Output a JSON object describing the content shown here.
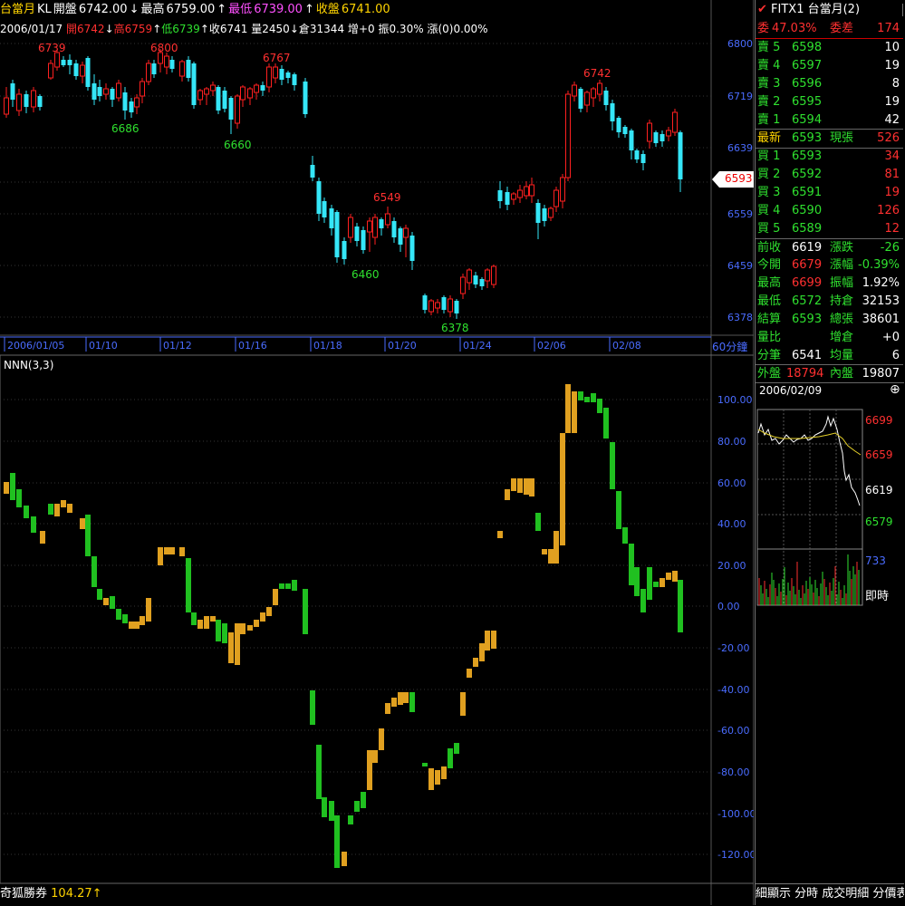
{
  "header": {
    "name": "台當月",
    "kl": "KL",
    "open_label": "開盤",
    "open": "6742.00",
    "high_label": "最高",
    "high": "6759.00",
    "low_label": "最低",
    "low": "6739.00",
    "close_label": "收盤",
    "close": "6741.00"
  },
  "subheader": {
    "date": "2006/01/17",
    "open_label": "開",
    "open": "6742",
    "high_label": "高",
    "high": "6759",
    "low_label": "低",
    "low": "6739",
    "close_label": "收",
    "close": "6741",
    "vol_label": "量",
    "vol": "2450",
    "oi_label": "倉",
    "oi": "31344",
    "inc_label": "增",
    "inc": "+0",
    "amp_label": "振",
    "amp": "0.30%",
    "chg_label": "漲(0)",
    "chg": "0.00%"
  },
  "price_chart": {
    "y_ticks": [
      "6800",
      "6719",
      "6639",
      "6559",
      "6459",
      "6378"
    ],
    "last_price": "6593",
    "x_labels": [
      "2006/01/05",
      "01/10",
      "01/12",
      "01/16",
      "01/18",
      "01/20",
      "01/24",
      "02/06",
      "02/08"
    ],
    "period": "60分鐘",
    "annotations": [
      "6739",
      "6800",
      "6767",
      "6742",
      "6686",
      "6660",
      "6549",
      "6460",
      "6378"
    ]
  },
  "indicator": {
    "name": "NNN(3,3)",
    "y_ticks": [
      "100.00",
      "80.00",
      "60.00",
      "40.00",
      "20.00",
      "0.00",
      "-20.00",
      "-40.00",
      "-60.00",
      "-80.00",
      "-100.00",
      "-120.00"
    ]
  },
  "footer": {
    "broker": "奇狐勝券",
    "value": "104.27↑"
  },
  "quote": {
    "symbol": "FITX1 台當月(2)",
    "ratio_label": "委",
    "ratio": "47.03%",
    "diff_label": "委差",
    "diff": "174",
    "asks": [
      {
        "label": "賣 5",
        "price": "6598",
        "qty": "10"
      },
      {
        "label": "賣 4",
        "price": "6597",
        "qty": "19"
      },
      {
        "label": "賣 3",
        "price": "6596",
        "qty": "8"
      },
      {
        "label": "賣 2",
        "price": "6595",
        "qty": "19"
      },
      {
        "label": "賣 1",
        "price": "6594",
        "qty": "42"
      }
    ],
    "last_label": "最新",
    "last": "6593",
    "cur_label": "現張",
    "cur": "526",
    "bids": [
      {
        "label": "買 1",
        "price": "6593",
        "qty": "34"
      },
      {
        "label": "買 2",
        "price": "6592",
        "qty": "81"
      },
      {
        "label": "買 3",
        "price": "6591",
        "qty": "19"
      },
      {
        "label": "買 4",
        "price": "6590",
        "qty": "126"
      },
      {
        "label": "買 5",
        "price": "6589",
        "qty": "12"
      }
    ],
    "stats": [
      {
        "l1": "前收",
        "v1": "6619",
        "c1": "white",
        "l2": "漲跌",
        "v2": "-26",
        "c2": "green"
      },
      {
        "l1": "今開",
        "v1": "6679",
        "c1": "red",
        "l2": "漲幅",
        "v2": "-0.39%",
        "c2": "green"
      },
      {
        "l1": "最高",
        "v1": "6699",
        "c1": "red",
        "l2": "振幅",
        "v2": "1.92%",
        "c2": "white"
      },
      {
        "l1": "最低",
        "v1": "6572",
        "c1": "green",
        "l2": "持倉",
        "v2": "32153",
        "c2": "white"
      },
      {
        "l1": "結算",
        "v1": "6593",
        "c1": "green",
        "l2": "總張",
        "v2": "38601",
        "c2": "white"
      },
      {
        "l1": "量比",
        "v1": "",
        "c1": "white",
        "l2": "增倉",
        "v2": "+0",
        "c2": "white"
      },
      {
        "l1": "分筆",
        "v1": "6541",
        "c1": "white",
        "l2": "均量",
        "v2": "6",
        "c2": "white"
      }
    ],
    "outer_label": "外盤",
    "outer": "18794",
    "inner_label": "內盤",
    "inner": "19807"
  },
  "mini_chart": {
    "date": "2006/02/09",
    "prices": [
      "6699",
      "6659",
      "6619",
      "6579"
    ],
    "vol": "733",
    "mode": "即時"
  },
  "status_bar": {
    "text": "細顯示 分時 成交明細 分價表"
  },
  "colors": {
    "up": "#ff2020",
    "down": "#35e6f7",
    "ind_up": "#e0a020",
    "ind_down": "#20c020",
    "axis": "#4a6cff"
  }
}
